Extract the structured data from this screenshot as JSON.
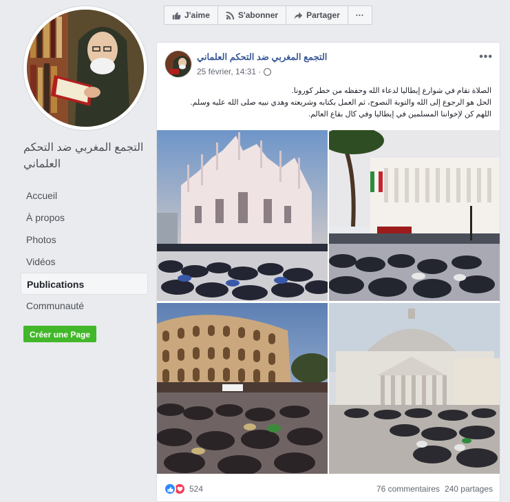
{
  "page": {
    "name": "التجمع المغربي ضد التحكم العلماني",
    "nav": [
      "Accueil",
      "À propos",
      "Photos",
      "Vidéos",
      "Publications",
      "Communauté"
    ],
    "active_nav": "Publications",
    "create_page_label": "Créer une Page"
  },
  "actions": {
    "like": "J'aime",
    "subscribe": "S'abonner",
    "share": "Partager",
    "more": "···"
  },
  "post": {
    "author": "التجمع المغربي ضد التحكم العلماني",
    "date": "25 février, 14:31 ·",
    "more": "•••",
    "text_lines": [
      "الصلاة تقام في شوارع إيطاليا لدعاء الله وحفظه من خطر كورونا.",
      "الحل هو الرجوع إلى الله والتوبة النصوح، ثم العمل بكتابه وشريعته وهدي نبيه صلى الله عليه وسلم.",
      "اللهم كن لإخواننا المسلمين في إيطاليا وفي كال بقاع العالم."
    ],
    "reaction_count": "524",
    "comments": "76 commentaires",
    "shares": "240 partages"
  },
  "colors": {
    "link": "#385898",
    "create_button": "#42b72a",
    "like": "#2d88ff",
    "love": "#f33e58",
    "background": "#e9ebee"
  }
}
